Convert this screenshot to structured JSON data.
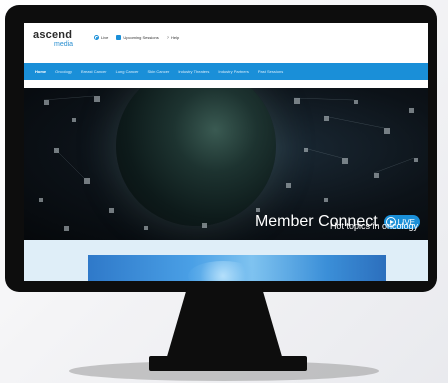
{
  "brand": {
    "logo_main": "ascend",
    "logo_sub": "media"
  },
  "top_links": {
    "live": "Live",
    "upcoming": "Upcoming Sessions",
    "help": "Help"
  },
  "nav": {
    "items": [
      {
        "label": "Home",
        "active": true
      },
      {
        "label": "Oncology",
        "active": false
      },
      {
        "label": "Breast Cancer",
        "active": false
      },
      {
        "label": "Lung Cancer",
        "active": false
      },
      {
        "label": "Skin Cancer",
        "active": false
      },
      {
        "label": "Industry Theaters",
        "active": false
      },
      {
        "label": "Industry Partners",
        "active": false
      },
      {
        "label": "Past Sessions",
        "active": false
      }
    ]
  },
  "hero": {
    "title": "Member Connect",
    "live_badge": "LIVE",
    "subtitle": "Hot topics in oncology"
  },
  "colors": {
    "accent": "#1a8fd8",
    "bezel": "#0d0d0d",
    "lower_bg": "#dfeef8"
  }
}
